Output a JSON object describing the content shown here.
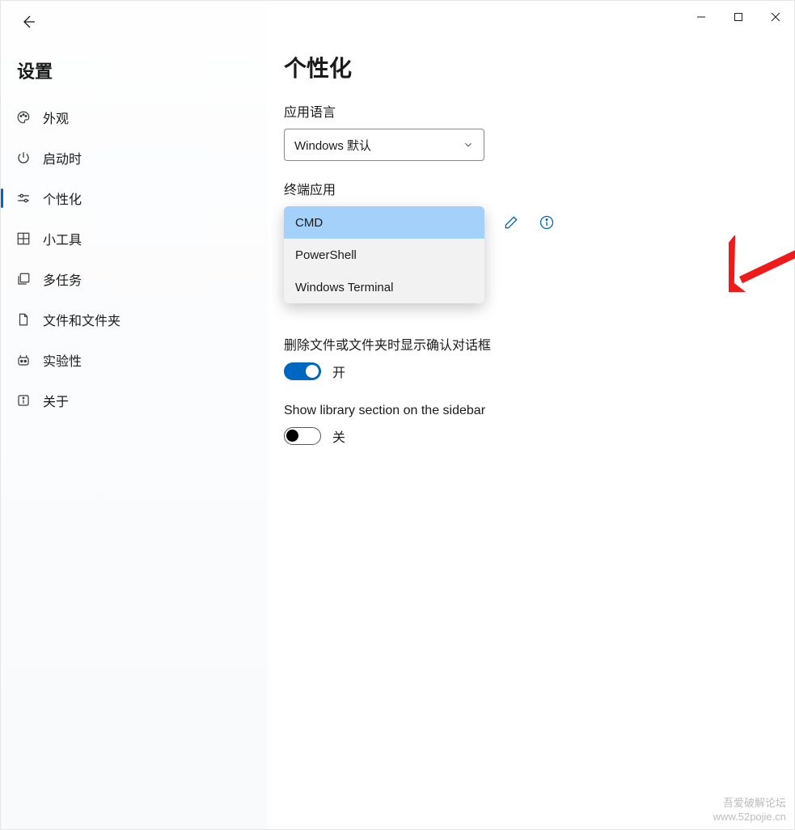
{
  "window": {
    "sidebar_title": "设置",
    "page_title": "个性化"
  },
  "nav": {
    "items": [
      {
        "id": "appearance",
        "label": "外观"
      },
      {
        "id": "startup",
        "label": "启动时"
      },
      {
        "id": "personalize",
        "label": "个性化",
        "active": true
      },
      {
        "id": "widgets",
        "label": "小工具"
      },
      {
        "id": "multitask",
        "label": "多任务"
      },
      {
        "id": "files",
        "label": "文件和文件夹"
      },
      {
        "id": "experimental",
        "label": "实验性"
      },
      {
        "id": "about",
        "label": "关于"
      }
    ]
  },
  "settings": {
    "app_language": {
      "label": "应用语言",
      "selected": "Windows 默认"
    },
    "terminal_app": {
      "label": "终端应用",
      "options": [
        "CMD",
        "PowerShell",
        "Windows Terminal"
      ],
      "highlighted_index": 0
    },
    "delete_confirm": {
      "label": "删除文件或文件夹时显示确认对话框",
      "value": "开",
      "on": true
    },
    "show_library": {
      "label": "Show library section on the sidebar",
      "value": "关",
      "on": false
    }
  },
  "watermark": {
    "line1": "吾爱破解论坛",
    "line2": "www.52pojie.cn"
  },
  "colors": {
    "accent": "#0067c0",
    "highlight": "#a3d1fa",
    "arrow": "#ef1a1a"
  }
}
